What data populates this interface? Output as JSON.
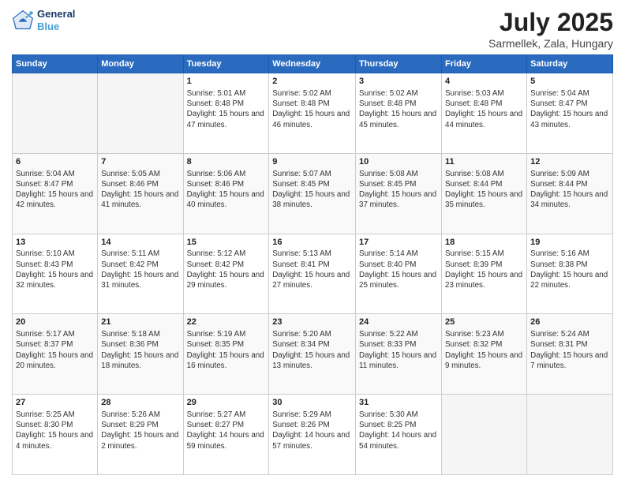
{
  "logo": {
    "line1": "General",
    "line2": "Blue"
  },
  "title": "July 2025",
  "subtitle": "Sarmellek, Zala, Hungary",
  "weekdays": [
    "Sunday",
    "Monday",
    "Tuesday",
    "Wednesday",
    "Thursday",
    "Friday",
    "Saturday"
  ],
  "weeks": [
    [
      {
        "day": "",
        "info": ""
      },
      {
        "day": "",
        "info": ""
      },
      {
        "day": "1",
        "info": "Sunrise: 5:01 AM\nSunset: 8:48 PM\nDaylight: 15 hours and 47 minutes."
      },
      {
        "day": "2",
        "info": "Sunrise: 5:02 AM\nSunset: 8:48 PM\nDaylight: 15 hours and 46 minutes."
      },
      {
        "day": "3",
        "info": "Sunrise: 5:02 AM\nSunset: 8:48 PM\nDaylight: 15 hours and 45 minutes."
      },
      {
        "day": "4",
        "info": "Sunrise: 5:03 AM\nSunset: 8:48 PM\nDaylight: 15 hours and 44 minutes."
      },
      {
        "day": "5",
        "info": "Sunrise: 5:04 AM\nSunset: 8:47 PM\nDaylight: 15 hours and 43 minutes."
      }
    ],
    [
      {
        "day": "6",
        "info": "Sunrise: 5:04 AM\nSunset: 8:47 PM\nDaylight: 15 hours and 42 minutes."
      },
      {
        "day": "7",
        "info": "Sunrise: 5:05 AM\nSunset: 8:46 PM\nDaylight: 15 hours and 41 minutes."
      },
      {
        "day": "8",
        "info": "Sunrise: 5:06 AM\nSunset: 8:46 PM\nDaylight: 15 hours and 40 minutes."
      },
      {
        "day": "9",
        "info": "Sunrise: 5:07 AM\nSunset: 8:45 PM\nDaylight: 15 hours and 38 minutes."
      },
      {
        "day": "10",
        "info": "Sunrise: 5:08 AM\nSunset: 8:45 PM\nDaylight: 15 hours and 37 minutes."
      },
      {
        "day": "11",
        "info": "Sunrise: 5:08 AM\nSunset: 8:44 PM\nDaylight: 15 hours and 35 minutes."
      },
      {
        "day": "12",
        "info": "Sunrise: 5:09 AM\nSunset: 8:44 PM\nDaylight: 15 hours and 34 minutes."
      }
    ],
    [
      {
        "day": "13",
        "info": "Sunrise: 5:10 AM\nSunset: 8:43 PM\nDaylight: 15 hours and 32 minutes."
      },
      {
        "day": "14",
        "info": "Sunrise: 5:11 AM\nSunset: 8:42 PM\nDaylight: 15 hours and 31 minutes."
      },
      {
        "day": "15",
        "info": "Sunrise: 5:12 AM\nSunset: 8:42 PM\nDaylight: 15 hours and 29 minutes."
      },
      {
        "day": "16",
        "info": "Sunrise: 5:13 AM\nSunset: 8:41 PM\nDaylight: 15 hours and 27 minutes."
      },
      {
        "day": "17",
        "info": "Sunrise: 5:14 AM\nSunset: 8:40 PM\nDaylight: 15 hours and 25 minutes."
      },
      {
        "day": "18",
        "info": "Sunrise: 5:15 AM\nSunset: 8:39 PM\nDaylight: 15 hours and 23 minutes."
      },
      {
        "day": "19",
        "info": "Sunrise: 5:16 AM\nSunset: 8:38 PM\nDaylight: 15 hours and 22 minutes."
      }
    ],
    [
      {
        "day": "20",
        "info": "Sunrise: 5:17 AM\nSunset: 8:37 PM\nDaylight: 15 hours and 20 minutes."
      },
      {
        "day": "21",
        "info": "Sunrise: 5:18 AM\nSunset: 8:36 PM\nDaylight: 15 hours and 18 minutes."
      },
      {
        "day": "22",
        "info": "Sunrise: 5:19 AM\nSunset: 8:35 PM\nDaylight: 15 hours and 16 minutes."
      },
      {
        "day": "23",
        "info": "Sunrise: 5:20 AM\nSunset: 8:34 PM\nDaylight: 15 hours and 13 minutes."
      },
      {
        "day": "24",
        "info": "Sunrise: 5:22 AM\nSunset: 8:33 PM\nDaylight: 15 hours and 11 minutes."
      },
      {
        "day": "25",
        "info": "Sunrise: 5:23 AM\nSunset: 8:32 PM\nDaylight: 15 hours and 9 minutes."
      },
      {
        "day": "26",
        "info": "Sunrise: 5:24 AM\nSunset: 8:31 PM\nDaylight: 15 hours and 7 minutes."
      }
    ],
    [
      {
        "day": "27",
        "info": "Sunrise: 5:25 AM\nSunset: 8:30 PM\nDaylight: 15 hours and 4 minutes."
      },
      {
        "day": "28",
        "info": "Sunrise: 5:26 AM\nSunset: 8:29 PM\nDaylight: 15 hours and 2 minutes."
      },
      {
        "day": "29",
        "info": "Sunrise: 5:27 AM\nSunset: 8:27 PM\nDaylight: 14 hours and 59 minutes."
      },
      {
        "day": "30",
        "info": "Sunrise: 5:29 AM\nSunset: 8:26 PM\nDaylight: 14 hours and 57 minutes."
      },
      {
        "day": "31",
        "info": "Sunrise: 5:30 AM\nSunset: 8:25 PM\nDaylight: 14 hours and 54 minutes."
      },
      {
        "day": "",
        "info": ""
      },
      {
        "day": "",
        "info": ""
      }
    ]
  ]
}
